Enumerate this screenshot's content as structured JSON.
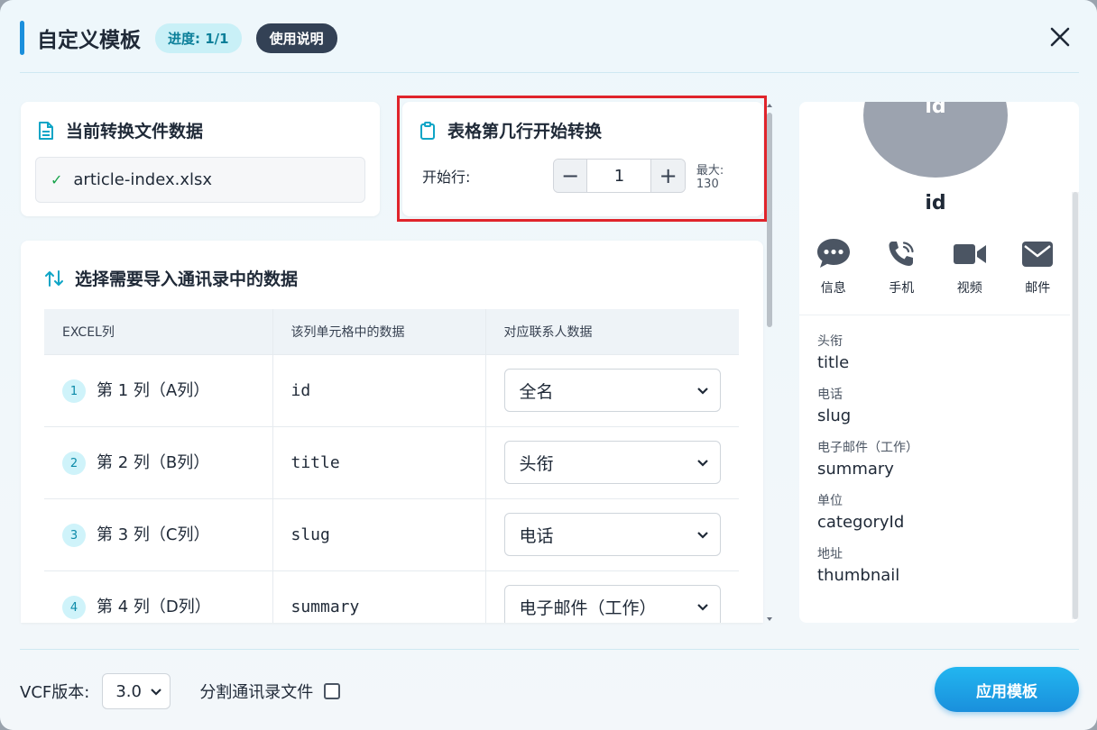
{
  "header": {
    "title": "自定义模板",
    "progress": "进度: 1/1",
    "help_label": "使用说明"
  },
  "file_card": {
    "title": "当前转换文件数据",
    "file_name": "article-index.xlsx",
    "check": "✓"
  },
  "start_card": {
    "title": "表格第几行开始转换",
    "label": "开始行:",
    "value": "1",
    "minus": "−",
    "plus": "+",
    "max_label": "最大: 130"
  },
  "mapping": {
    "title": "选择需要导入通讯录中的数据",
    "columns": [
      "EXCEL列",
      "该列单元格中的数据",
      "对应联系人数据"
    ],
    "rows": [
      {
        "index": "1",
        "column": "第 1 列（A列）",
        "cell": "id",
        "field": "全名"
      },
      {
        "index": "2",
        "column": "第 2 列（B列）",
        "cell": "title",
        "field": "头衔"
      },
      {
        "index": "3",
        "column": "第 3 列（C列）",
        "cell": "slug",
        "field": "电话"
      },
      {
        "index": "4",
        "column": "第 4 列（D列）",
        "cell": "summary",
        "field": "电子邮件（工作）"
      }
    ]
  },
  "contact": {
    "avatar_text": "id",
    "name": "id",
    "actions": [
      {
        "label": "信息",
        "icon": "message-icon"
      },
      {
        "label": "手机",
        "icon": "phone-icon"
      },
      {
        "label": "视频",
        "icon": "video-icon"
      },
      {
        "label": "邮件",
        "icon": "mail-icon"
      }
    ],
    "fields": [
      {
        "label": "头衔",
        "value": "title"
      },
      {
        "label": "电话",
        "value": "slug"
      },
      {
        "label": "电子邮件（工作）",
        "value": "summary"
      },
      {
        "label": "单位",
        "value": "categoryId"
      },
      {
        "label": "地址",
        "value": "thumbnail"
      }
    ]
  },
  "footer": {
    "vcf_label": "VCF版本:",
    "vcf_value": "3.0",
    "split_label": "分割通讯录文件",
    "apply_label": "应用模板"
  },
  "colors": {
    "accent": "#1a8fdc",
    "highlight": "#e0242b"
  }
}
